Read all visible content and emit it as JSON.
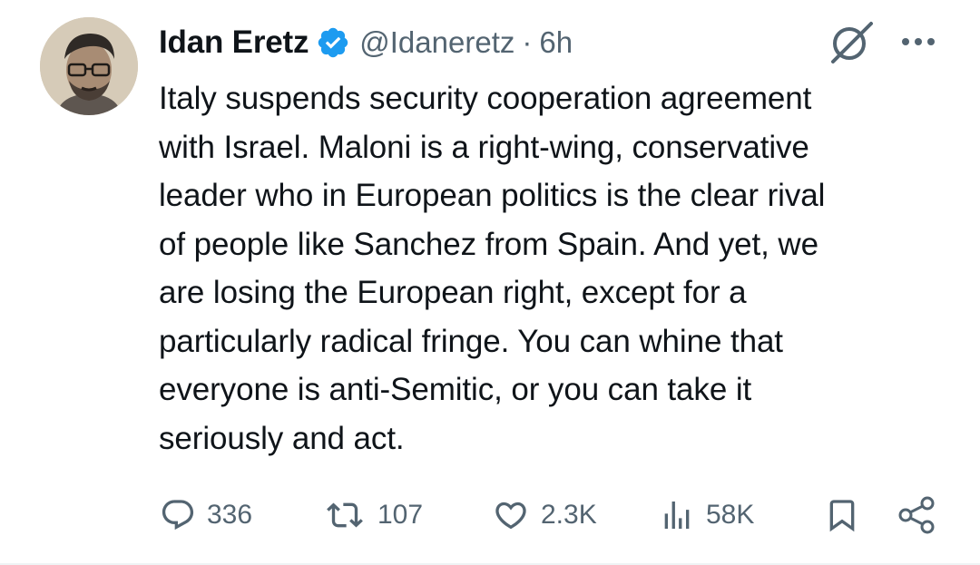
{
  "author": {
    "name": "Idan Eretz",
    "handle": "@Idaneretz",
    "time": "6h",
    "separator": "·",
    "verified": true
  },
  "tweet": {
    "text": "Italy suspends security cooperation agreement\nwith Israel. Maloni is a right-wing, conservative\nleader who in European politics is the clear rival\nof people like Sanchez from Spain. And yet, we\nare losing the European right, except for a\nparticularly radical fringe. You can whine that\neveryone is anti-Semitic, or you can take it\nseriously and act."
  },
  "actions": {
    "replies": "336",
    "reposts": "107",
    "likes": "2.3K",
    "views": "58K"
  },
  "icons": {
    "verified": "verified-badge-icon",
    "grok": "grok-icon",
    "more": "more-icon",
    "reply": "reply-icon",
    "repost": "repost-icon",
    "like": "heart-icon",
    "views": "views-icon",
    "bookmark": "bookmark-icon",
    "share": "share-icon"
  },
  "colors": {
    "text": "#0f1419",
    "secondary": "#536471",
    "verified_blue": "#1d9bf0"
  }
}
